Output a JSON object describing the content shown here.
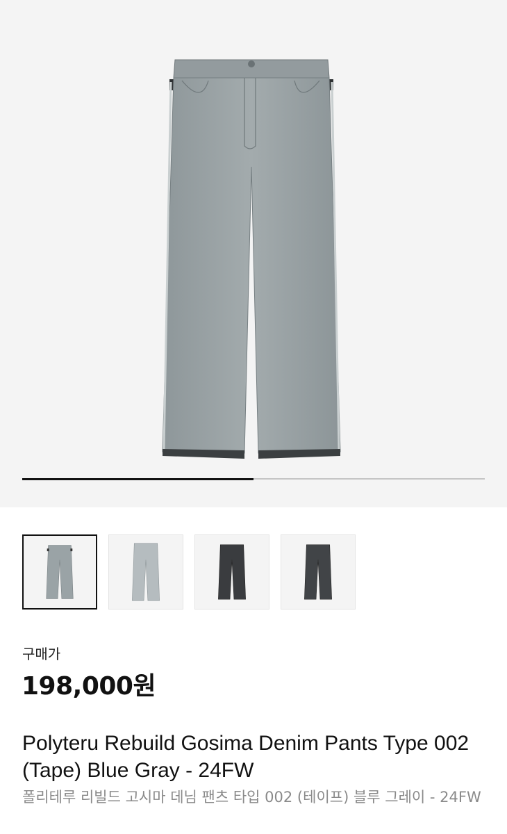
{
  "gallery": {
    "current_image": "blue-gray-denim-pants-front",
    "progress": 0.5,
    "background_color": "#f4f4f4",
    "thumbnails": [
      {
        "image": "blue-gray-denim-pants-front",
        "selected": true
      },
      {
        "image": "blue-gray-denim-pants-back",
        "selected": false
      },
      {
        "image": "black-denim-pants-front",
        "selected": false
      },
      {
        "image": "black-denim-pants-back",
        "selected": false
      }
    ]
  },
  "price": {
    "label": "구매가",
    "value": "198,000원"
  },
  "product": {
    "name_en": "Polyteru Rebuild Gosima Denim Pants Type 002 (Tape) Blue Gray - 24FW",
    "name_ko": "폴리테루 리빌드 고시마 데님 팬츠 타입 002 (테이프) 블루 그레이 - 24FW"
  },
  "colors": {
    "blue_gray_denim": "#9aa3a6",
    "black_denim": "#3a3c3f",
    "selected_border": "#111111",
    "muted_text": "#8a8a8a"
  }
}
